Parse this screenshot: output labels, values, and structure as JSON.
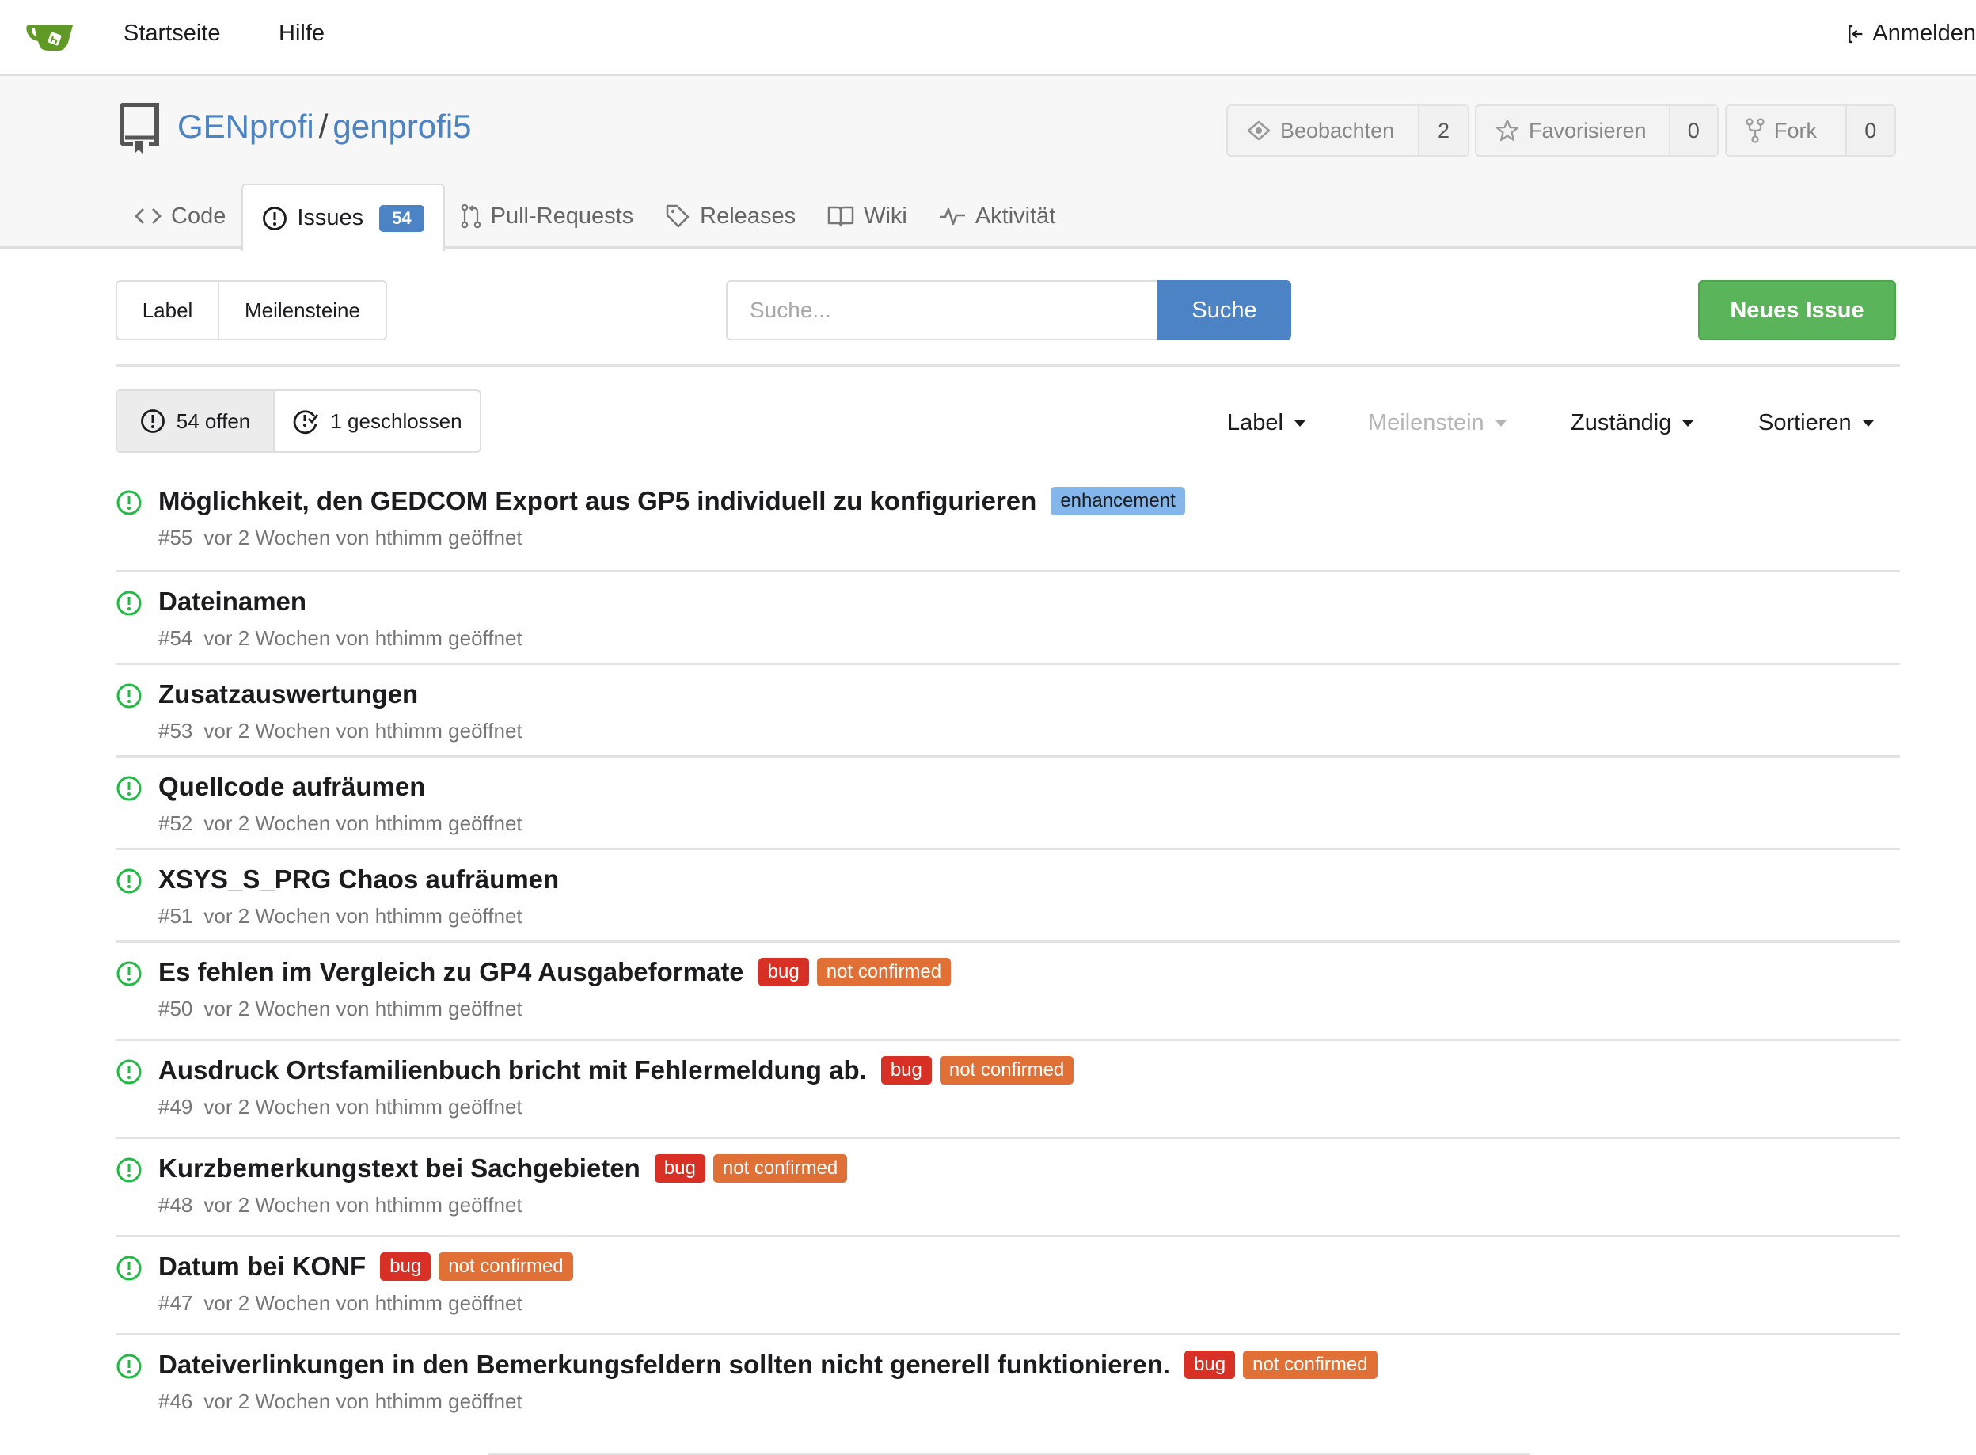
{
  "topnav": {
    "logo": "gitea-logo-icon",
    "links": [
      "Startseite",
      "Hilfe"
    ],
    "signin_label": "Anmelden",
    "signin_icon": "sign-in-icon"
  },
  "repo": {
    "owner": "GENprofi",
    "separator": "/",
    "name": "genprofi5",
    "watch_label": "Beobachten",
    "watch_count": "2",
    "star_label": "Favorisieren",
    "star_count": "0",
    "fork_label": "Fork",
    "fork_count": "0"
  },
  "tabs": [
    {
      "label": "Code",
      "icon": "code-icon"
    },
    {
      "label": "Issues",
      "icon": "issue-opened-icon",
      "badge": "54",
      "active": true
    },
    {
      "label": "Pull-Requests",
      "icon": "pull-request-icon"
    },
    {
      "label": "Releases",
      "icon": "tag-icon"
    },
    {
      "label": "Wiki",
      "icon": "book-icon"
    },
    {
      "label": "Aktivität",
      "icon": "pulse-icon"
    }
  ],
  "toolbar": {
    "label_btn": "Label",
    "milestones_btn": "Meilensteine",
    "search_placeholder": "Suche...",
    "search_value": "",
    "search_btn": "Suche",
    "new_issue_btn": "Neues Issue"
  },
  "state_filter": {
    "open_label": "54 offen",
    "closed_label": "1 geschlossen"
  },
  "filters": {
    "label": "Label",
    "milestone": "Meilenstein",
    "assignee": "Zuständig",
    "sort": "Sortieren"
  },
  "colors": {
    "accent_blue": "#4b83c4",
    "green": "#5ab45a",
    "open_icon": "#21ba45",
    "bug": "#d93025",
    "not_confirmed": "#e07035",
    "enhancement": "#84b6eb"
  },
  "issues": [
    {
      "title": "Möglichkeit, den GEDCOM Export aus GP5 individuell zu konfigurieren",
      "number": "#55",
      "meta": "vor 2 Wochen von hthimm geöffnet",
      "labels": [
        {
          "text": "enhancement",
          "bg": "#84b6eb",
          "fg": "#1b1c1d"
        }
      ]
    },
    {
      "title": "Dateinamen",
      "number": "#54",
      "meta": "vor 2 Wochen von hthimm geöffnet",
      "labels": []
    },
    {
      "title": "Zusatzauswertungen",
      "number": "#53",
      "meta": "vor 2 Wochen von hthimm geöffnet",
      "labels": []
    },
    {
      "title": "Quellcode aufräumen",
      "number": "#52",
      "meta": "vor 2 Wochen von hthimm geöffnet",
      "labels": []
    },
    {
      "title": "XSYS_S_PRG Chaos aufräumen",
      "number": "#51",
      "meta": "vor 2 Wochen von hthimm geöffnet",
      "labels": []
    },
    {
      "title": "Es fehlen im Vergleich zu GP4 Ausgabeformate",
      "number": "#50",
      "meta": "vor 2 Wochen von hthimm geöffnet",
      "labels": [
        {
          "text": "bug",
          "bg": "#d93025",
          "fg": "#ffffff"
        },
        {
          "text": "not confirmed",
          "bg": "#e07035",
          "fg": "#ffffff"
        }
      ]
    },
    {
      "title": "Ausdruck Ortsfamilienbuch bricht mit Fehlermeldung ab.",
      "number": "#49",
      "meta": "vor 2 Wochen von hthimm geöffnet",
      "labels": [
        {
          "text": "bug",
          "bg": "#d93025",
          "fg": "#ffffff"
        },
        {
          "text": "not confirmed",
          "bg": "#e07035",
          "fg": "#ffffff"
        }
      ]
    },
    {
      "title": "Kurzbemerkungstext bei Sachgebieten",
      "number": "#48",
      "meta": "vor 2 Wochen von hthimm geöffnet",
      "labels": [
        {
          "text": "bug",
          "bg": "#d93025",
          "fg": "#ffffff"
        },
        {
          "text": "not confirmed",
          "bg": "#e07035",
          "fg": "#ffffff"
        }
      ]
    },
    {
      "title": "Datum bei KONF",
      "number": "#47",
      "meta": "vor 2 Wochen von hthimm geöffnet",
      "labels": [
        {
          "text": "bug",
          "bg": "#d93025",
          "fg": "#ffffff"
        },
        {
          "text": "not confirmed",
          "bg": "#e07035",
          "fg": "#ffffff"
        }
      ]
    },
    {
      "title": "Dateiverlinkungen in den Bemerkungsfeldern sollten nicht generell funktionieren.",
      "number": "#46",
      "meta": "vor 2 Wochen von hthimm geöffnet",
      "labels": [
        {
          "text": "bug",
          "bg": "#d93025",
          "fg": "#ffffff"
        },
        {
          "text": "not confirmed",
          "bg": "#e07035",
          "fg": "#ffffff"
        }
      ]
    }
  ]
}
